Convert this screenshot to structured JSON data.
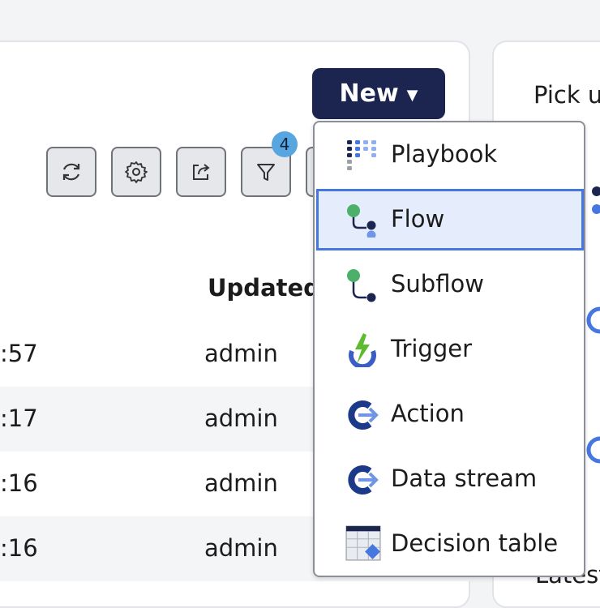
{
  "header": {
    "new_button_label": "New",
    "pick_text": "Pick u",
    "latest_text": "Latest"
  },
  "toolbar": {
    "filter_count": "4",
    "tools": [
      {
        "icon": "refresh-icon"
      },
      {
        "icon": "gear-icon"
      },
      {
        "icon": "share-icon"
      },
      {
        "icon": "filter-icon"
      }
    ]
  },
  "table": {
    "updated_header": "Updated",
    "rows": [
      {
        "time": ":57",
        "user": "admin"
      },
      {
        "time": ":17",
        "user": "admin"
      },
      {
        "time": ":16",
        "user": "admin"
      },
      {
        "time": ":16",
        "user": "admin"
      }
    ]
  },
  "menu": {
    "selected_index": 1,
    "items": [
      {
        "label": "Playbook",
        "icon": "playbook-icon"
      },
      {
        "label": "Flow",
        "icon": "flow-icon"
      },
      {
        "label": "Subflow",
        "icon": "subflow-icon"
      },
      {
        "label": "Trigger",
        "icon": "trigger-icon"
      },
      {
        "label": "Action",
        "icon": "action-icon"
      },
      {
        "label": "Data stream",
        "icon": "data-stream-icon"
      },
      {
        "label": "Decision table",
        "icon": "decision-table-icon"
      }
    ]
  },
  "colors": {
    "brand_navy": "#1b2550",
    "accent_blue": "#4676e0",
    "badge_blue": "#58a6e0",
    "green": "#4caf6a"
  }
}
